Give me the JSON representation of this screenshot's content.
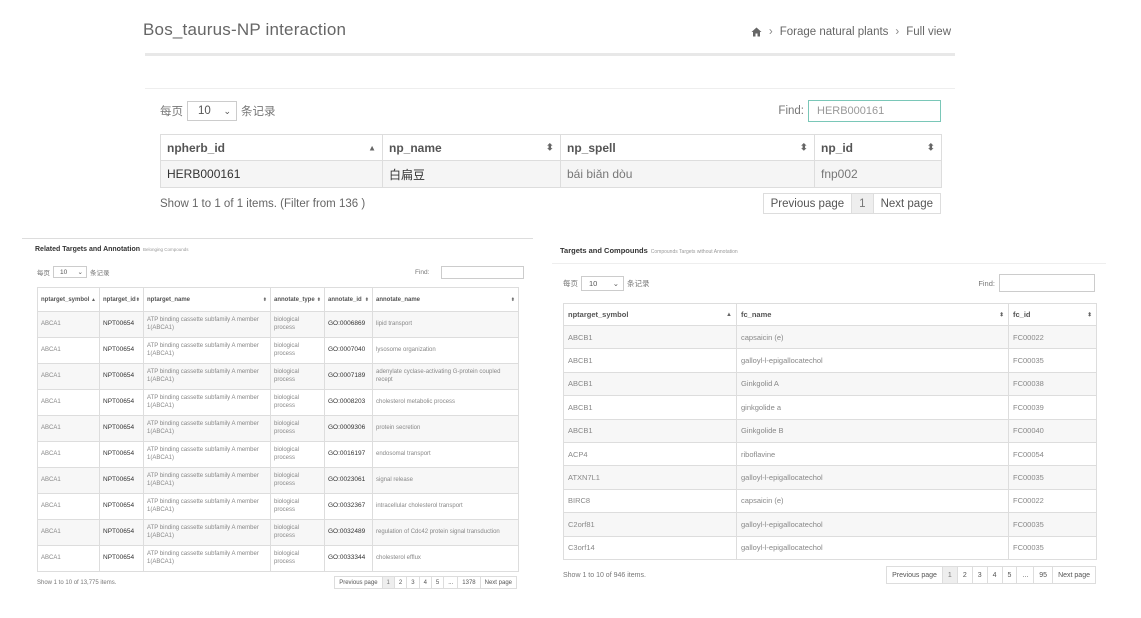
{
  "header": {
    "title": "Bos_taurus-NP interaction",
    "breadcrumb": [
      "Forage natural plants",
      "Full view"
    ]
  },
  "top_panel": {
    "per_page_prefix": "每页",
    "per_page_value": "10",
    "per_page_suffix": "条记录",
    "find_label": "Find:",
    "find_value": "HERB000161",
    "columns": [
      "npherb_id",
      "np_name",
      "np_spell",
      "np_id"
    ],
    "rows": [
      [
        "HERB000161",
        "白扁豆",
        "bái biǎn dòu",
        "fnp002"
      ]
    ],
    "info": "Show 1 to 1 of 1 items.  (Filter from 136 )",
    "pager": [
      "Previous page",
      "1",
      "Next page"
    ]
  },
  "left_panel": {
    "title": "Related Targets and Annotation",
    "subtitle": "Belonging Compounds",
    "per_page_prefix": "每页",
    "per_page_value": "10",
    "per_page_suffix": "条记录",
    "find_label": "Find:",
    "find_value": "",
    "columns": [
      "nptarget_symbol",
      "nptarget_id",
      "nptarget_name",
      "annotate_type",
      "annotate_id",
      "annotate_name"
    ],
    "rows": [
      [
        "ABCA1",
        "NPT00654",
        "ATP binding cassette subfamily A member 1(ABCA1)",
        "biological process",
        "GO:0006869",
        "lipid transport"
      ],
      [
        "ABCA1",
        "NPT00654",
        "ATP binding cassette subfamily A member 1(ABCA1)",
        "biological process",
        "GO:0007040",
        "lysosome organization"
      ],
      [
        "ABCA1",
        "NPT00654",
        "ATP binding cassette subfamily A member 1(ABCA1)",
        "biological process",
        "GO:0007189",
        "adenylate cyclase-activating G-protein coupled recept"
      ],
      [
        "ABCA1",
        "NPT00654",
        "ATP binding cassette subfamily A member 1(ABCA1)",
        "biological process",
        "GO:0008203",
        "cholesterol metabolic process"
      ],
      [
        "ABCA1",
        "NPT00654",
        "ATP binding cassette subfamily A member 1(ABCA1)",
        "biological process",
        "GO:0009306",
        "protein secretion"
      ],
      [
        "ABCA1",
        "NPT00654",
        "ATP binding cassette subfamily A member 1(ABCA1)",
        "biological process",
        "GO:0016197",
        "endosomal transport"
      ],
      [
        "ABCA1",
        "NPT00654",
        "ATP binding cassette subfamily A member 1(ABCA1)",
        "biological process",
        "GO:0023061",
        "signal release"
      ],
      [
        "ABCA1",
        "NPT00654",
        "ATP binding cassette subfamily A member 1(ABCA1)",
        "biological process",
        "GO:0032367",
        "intracellular cholesterol transport"
      ],
      [
        "ABCA1",
        "NPT00654",
        "ATP binding cassette subfamily A member 1(ABCA1)",
        "biological process",
        "GO:0032489",
        "regulation of Cdc42 protein signal transduction"
      ],
      [
        "ABCA1",
        "NPT00654",
        "ATP binding cassette subfamily A member 1(ABCA1)",
        "biological process",
        "GO:0033344",
        "cholesterol efflux"
      ]
    ],
    "info": "Show 1 to 10 of 13,775 items.",
    "pager": [
      "Previous page",
      "1",
      "2",
      "3",
      "4",
      "5",
      "...",
      "1378",
      "Next page"
    ]
  },
  "right_panel": {
    "title": "Targets and Compounds",
    "subtitle": "Compounds Targets without Annotation",
    "per_page_prefix": "每页",
    "per_page_value": "10",
    "per_page_suffix": "条记录",
    "find_label": "Find:",
    "find_value": "",
    "columns": [
      "nptarget_symbol",
      "fc_name",
      "fc_id"
    ],
    "rows": [
      [
        "ABCB1",
        "capsaicin (e)",
        "FC00022"
      ],
      [
        "ABCB1",
        "galloyl-l-epigallocatechol",
        "FC00035"
      ],
      [
        "ABCB1",
        "Ginkgolid A",
        "FC00038"
      ],
      [
        "ABCB1",
        "ginkgolide a",
        "FC00039"
      ],
      [
        "ABCB1",
        "Ginkgolide B",
        "FC00040"
      ],
      [
        "ACP4",
        "riboflavine",
        "FC00054"
      ],
      [
        "ATXN7L1",
        "galloyl-l-epigallocatechol",
        "FC00035"
      ],
      [
        "BIRC8",
        "capsaicin (e)",
        "FC00022"
      ],
      [
        "C2orf81",
        "galloyl-l-epigallocatechol",
        "FC00035"
      ],
      [
        "C3orf14",
        "galloyl-l-epigallocatechol",
        "FC00035"
      ]
    ],
    "info": "Show 1 to 10 of 946 items.",
    "pager": [
      "Previous page",
      "1",
      "2",
      "3",
      "4",
      "5",
      "...",
      "95",
      "Next page"
    ]
  }
}
